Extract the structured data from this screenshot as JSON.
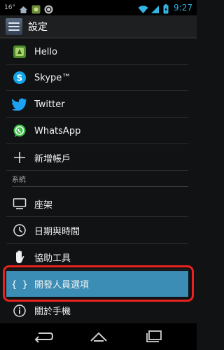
{
  "status_bar": {
    "temperature": "16°",
    "time": "9:27",
    "icons": [
      "home-icon",
      "photo-notification-icon",
      "sync-notification-icon",
      "wifi-icon",
      "signal-icon",
      "battery-icon"
    ]
  },
  "action_bar": {
    "title": "設定",
    "icon": "settings-icon"
  },
  "accounts": [
    {
      "label": "Hello",
      "icon": "hello-app-icon"
    },
    {
      "label": "Skype™",
      "icon": "skype-icon"
    },
    {
      "label": "Twitter",
      "icon": "twitter-icon"
    },
    {
      "label": "WhatsApp",
      "icon": "whatsapp-icon"
    },
    {
      "label": "新增帳戶",
      "icon": "plus-icon"
    }
  ],
  "system_section": {
    "header": "系統",
    "items": [
      {
        "label": "座架",
        "icon": "dock-icon"
      },
      {
        "label": "日期與時間",
        "icon": "clock-icon"
      },
      {
        "label": "協助工具",
        "icon": "hand-icon"
      },
      {
        "label": "開發人員選項",
        "icon": "braces-icon",
        "selected": true
      },
      {
        "label": "關於手機",
        "icon": "info-icon"
      }
    ]
  },
  "nav_bar": {
    "buttons": [
      "back-icon",
      "home-icon",
      "recents-icon"
    ]
  },
  "colors": {
    "accent_blue": "#33b5e5",
    "selected_row": "#3b8db5",
    "highlight_ring": "#e8231e",
    "background": "#111214"
  }
}
